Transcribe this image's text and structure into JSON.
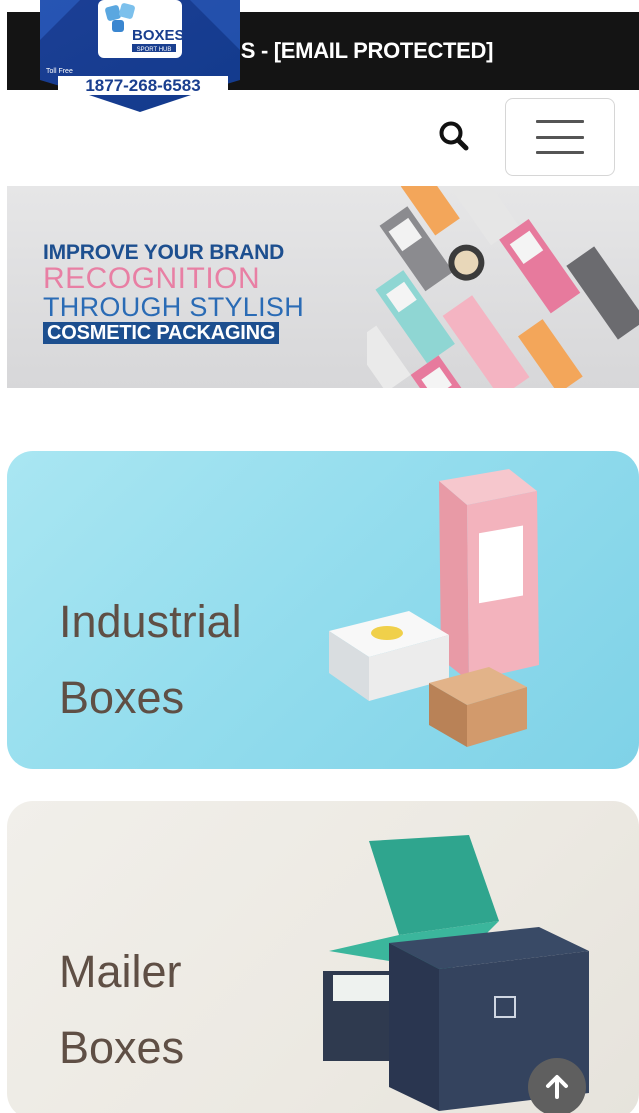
{
  "topbar": {
    "email_text": "EMAIL US - [EMAIL PROTECTED]"
  },
  "header": {
    "logo": {
      "brand": "BOXES",
      "sub": "SPORT HUB",
      "tollfree_label": "Toll Free",
      "phone": "1877-268-6583"
    },
    "search_icon": "search-icon",
    "menu_icon": "hamburger-menu-icon"
  },
  "banner": {
    "line1": "IMPROVE YOUR BRAND",
    "line2": "RECOGNITION",
    "line3": "THROUGH STYLISH",
    "line4": "COSMETIC PACKAGING"
  },
  "cards": [
    {
      "line1": "Industrial",
      "line2": "Boxes"
    },
    {
      "line1": "Mailer",
      "line2": "Boxes"
    }
  ],
  "colors": {
    "topbar_bg": "#141414",
    "brand_blue": "#1d4f8f",
    "banner_pink": "#e87fa4",
    "industrial_card_bg": "#92dced",
    "mailer_card_bg": "#ece9e2",
    "card_text": "#5f4f45"
  },
  "back_to_top_icon": "arrow-up-icon"
}
